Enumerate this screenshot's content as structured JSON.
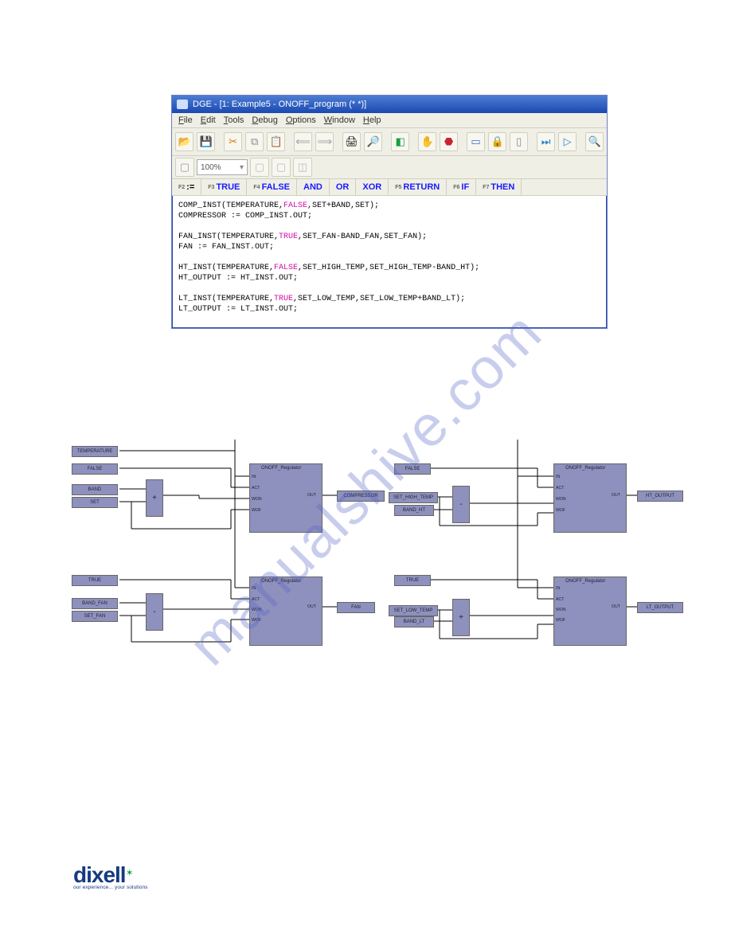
{
  "ide": {
    "title": "DGE - [1: Example5 - ONOFF_program (*  *)]",
    "menus": {
      "file": "File",
      "edit": "Edit",
      "tools": "Tools",
      "debug": "Debug",
      "options": "Options",
      "window": "Window",
      "help": "Help"
    },
    "zoom": "100%",
    "fkeys": {
      "f2": {
        "sup": "F2",
        "txt": ":="
      },
      "f3": {
        "sup": "F3",
        "txt": "TRUE"
      },
      "f4": {
        "sup": "F4",
        "txt": "FALSE"
      },
      "and": {
        "sup": "",
        "txt": "AND"
      },
      "or": {
        "sup": "",
        "txt": "OR"
      },
      "xor": {
        "sup": "",
        "txt": "XOR"
      },
      "f5": {
        "sup": "F5",
        "txt": "RETURN"
      },
      "f6": {
        "sup": "F6",
        "txt": "IF"
      },
      "f7": {
        "sup": "F7",
        "txt": "THEN"
      }
    },
    "code": {
      "l1a": "COMP_INST(TEMPERATURE,",
      "l1b": "FALSE",
      "l1c": ",SET+BAND,SET);",
      "l2": "COMPRESSOR := COMP_INST.OUT;",
      "l3": "",
      "l4a": "FAN_INST(TEMPERATURE,",
      "l4b": "TRUE",
      "l4c": ",SET_FAN-BAND_FAN,SET_FAN);",
      "l5": "FAN := FAN_INST.OUT;",
      "l6": "",
      "l7a": "HT_INST(TEMPERATURE,",
      "l7b": "FALSE",
      "l7c": ",SET_HIGH_TEMP,SET_HIGH_TEMP-BAND_HT);",
      "l8": "HT_OUTPUT := HT_INST.OUT;",
      "l9": "",
      "l10a": "LT_INST(TEMPERATURE,",
      "l10b": "TRUE",
      "l10c": ",SET_LOW_TEMP,SET_LOW_TEMP+BAND_LT);",
      "l11": "LT_OUTPUT := LT_INST.OUT;"
    }
  },
  "diagram": {
    "reg_title": "ONOFF_Regulator",
    "ports": {
      "in": "IN",
      "act": "ACT",
      "won": "WON",
      "wof": "WOF",
      "out": "OUT"
    },
    "ops": {
      "plus": "+",
      "minus": "-"
    },
    "tags": {
      "temperature": "TEMPERATURE",
      "false": "FALSE",
      "band": "BAND",
      "set": "SET",
      "true": "TRUE",
      "band_fan": "BAND_FAN",
      "set_fan": "SET_FAN",
      "compressor": "COMPRESSOR",
      "fan": "FAN",
      "set_high_temp": "SET_HIGH_TEMP",
      "band_ht": "BAND_HT",
      "ht_output": "HT_OUTPUT",
      "set_low_temp": "SET_LOW_TEMP",
      "band_lt": "BAND_LT",
      "lt_output": "LT_OUTPUT"
    }
  },
  "watermark": "manualshive.com",
  "logo": {
    "brand": "dixell",
    "tagline": "our experience... your solutions"
  }
}
